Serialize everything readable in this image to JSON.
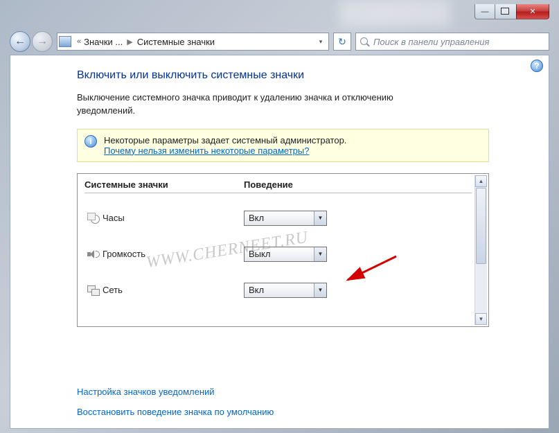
{
  "titlebar": {
    "min": "—",
    "max": "",
    "close": "✕"
  },
  "breadcrumb": {
    "level1": "Значки ...",
    "level2": "Системные значки"
  },
  "search": {
    "placeholder": "Поиск в панели управления"
  },
  "page": {
    "title": "Включить или выключить системные значки",
    "desc": "Выключение системного значка приводит к удалению значка и отключению уведомлений."
  },
  "info": {
    "text": "Некоторые параметры задает системный администратор.",
    "link": "Почему нельзя изменить некоторые параметры?"
  },
  "table": {
    "col_name": "Системные значки",
    "col_behavior": "Поведение",
    "rows": [
      {
        "label": "Часы",
        "value": "Вкл"
      },
      {
        "label": "Громкость",
        "value": "Выкл"
      },
      {
        "label": "Сеть",
        "value": "Вкл"
      }
    ]
  },
  "links": {
    "configure": "Настройка значков уведомлений",
    "restore": "Восстановить поведение значка по умолчанию"
  },
  "watermark": "WWW.CHERNEET.RU"
}
